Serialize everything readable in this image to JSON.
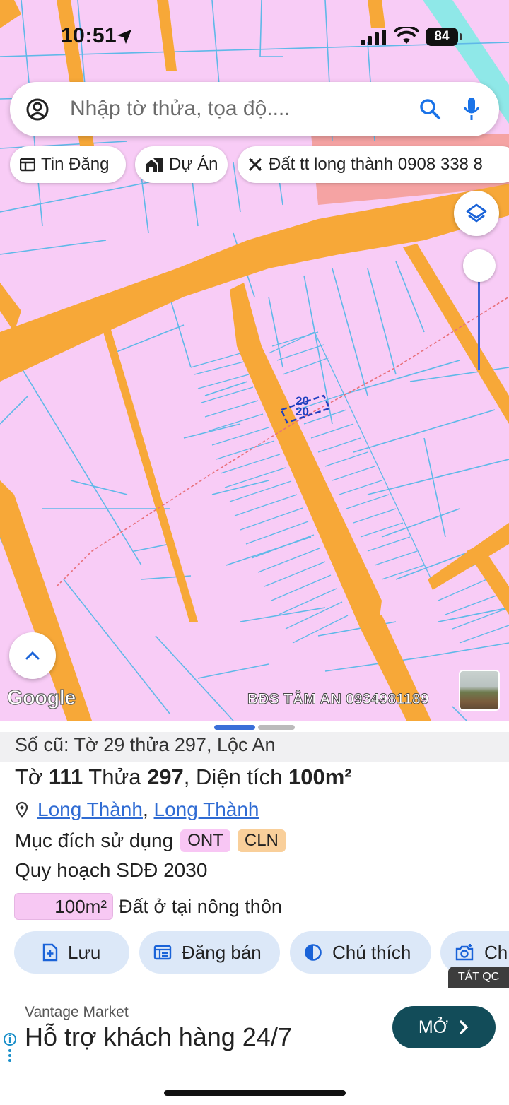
{
  "status_bar": {
    "time": "10:51",
    "battery": "84"
  },
  "search": {
    "placeholder": "Nhập tờ thửa, tọa độ...."
  },
  "chips": [
    {
      "label": "Tin Đăng",
      "icon": "news-icon"
    },
    {
      "label": "Dự Án",
      "icon": "home-work-icon"
    },
    {
      "label": "Đất tt long thành 0908 338 8",
      "icon": "tools-icon"
    }
  ],
  "map": {
    "parcel_label_top": "20",
    "parcel_label_bottom": "20",
    "google_logo": "Google",
    "watermark": "BĐS TÂM AN 0934981189",
    "colors": {
      "residential": "#f8ccf6",
      "road": "#f7a838",
      "boundary": "#5fb8e8",
      "water": "#8fe8e8",
      "commercial": "#f5a3a3"
    }
  },
  "panel": {
    "old_info": "Số cũ: Tờ 29 thửa 297, Lộc An",
    "sheet_label": "Tờ",
    "sheet_number": "111",
    "parcel_label": "Thửa",
    "parcel_number": "297",
    "area_label": "Diện tích",
    "area_value": "100m²",
    "location_ward": "Long Thành",
    "location_district": "Long Thành",
    "purpose_label": "Mục đích sử dụng",
    "purpose_tags": [
      "ONT",
      "CLN"
    ],
    "plan_label": "Quy hoạch SDĐ 2030",
    "plan_area": "100m²",
    "plan_desc": "Đất ở tại nông thôn"
  },
  "actions": [
    {
      "label": "Lưu",
      "icon": "save-file-icon"
    },
    {
      "label": "Đăng bán",
      "icon": "listing-icon"
    },
    {
      "label": "Chú thích",
      "icon": "legend-contrast-icon"
    },
    {
      "label": "Ch",
      "icon": "add-photo-icon"
    }
  ],
  "ad_badge": "TẮT QC",
  "ad": {
    "brand": "Vantage Market",
    "headline": "Hỗ trợ khách hàng 24/7",
    "cta": "MỞ"
  }
}
